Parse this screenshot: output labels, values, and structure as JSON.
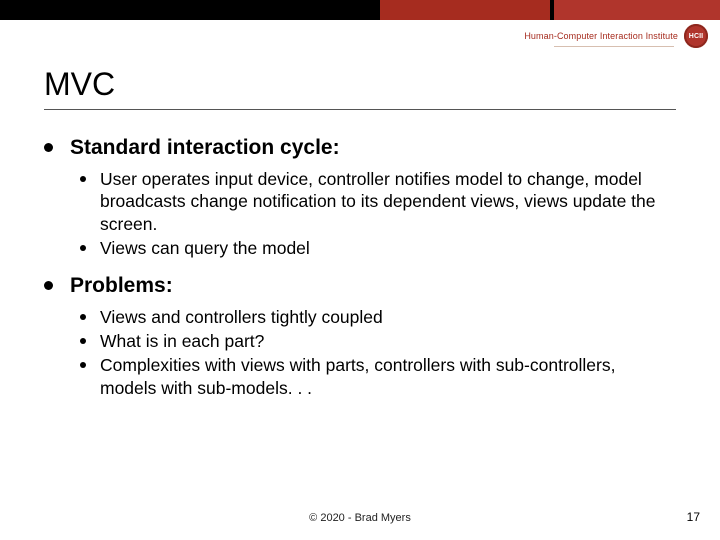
{
  "header": {
    "institute": "Human-Computer Interaction Institute",
    "logo_text": "HCII"
  },
  "title": "MVC",
  "sections": [
    {
      "heading": "Standard interaction cycle:",
      "items": [
        "User operates input device, controller notifies model to change, model broadcasts change notification to its dependent views, views update the screen.",
        "Views can query the model"
      ]
    },
    {
      "heading": "Problems:",
      "items": [
        "Views and controllers tightly coupled",
        "What is in each part?",
        "Complexities with views with parts, controllers with sub-controllers, models with sub-models. . ."
      ]
    }
  ],
  "footer": {
    "copyright": "© 2020 - Brad Myers",
    "page_number": "17"
  }
}
